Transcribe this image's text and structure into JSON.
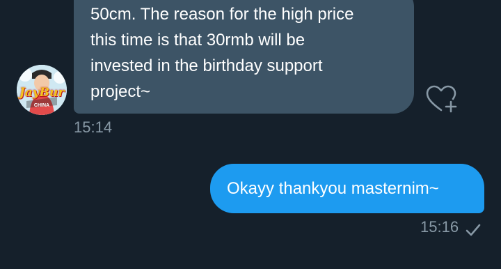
{
  "conversation": {
    "incoming": {
      "text": "50cm. The reason for the high price\nthis time is that 30rmb will be\ninvested in the birthday support\nproject~",
      "time": "15:14",
      "avatar": {
        "logo_text": "JayBur",
        "sub_text": "CHINA",
        "icon": "avatar-image"
      },
      "reaction_icon": "heart-plus-icon"
    },
    "outgoing": {
      "text": "Okayy thankyou masternim~",
      "time": "15:16",
      "status_icon": "checkmark-icon"
    }
  },
  "colors": {
    "background": "#15202b",
    "incoming_bubble": "#3d5466",
    "outgoing_bubble": "#1d9bf0",
    "timestamp": "#8899a6"
  }
}
